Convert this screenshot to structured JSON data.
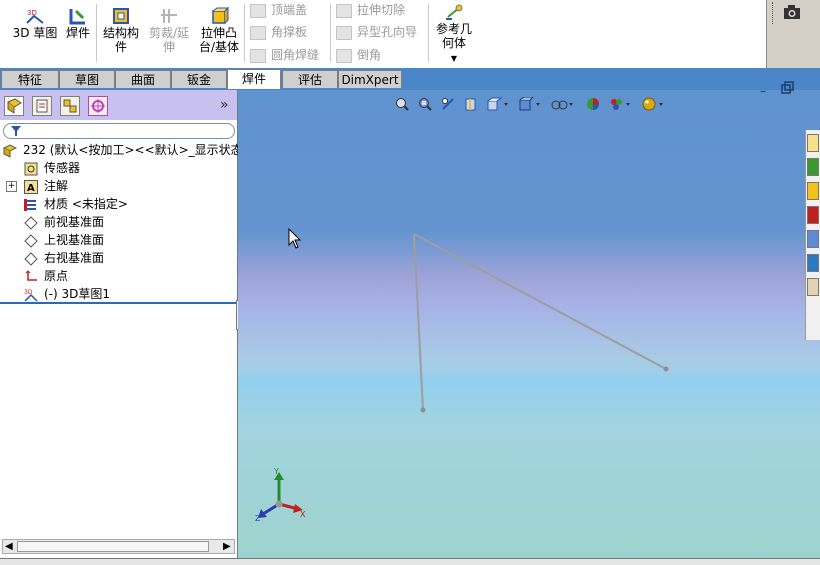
{
  "ribbon": {
    "sketch3d_label": "3D 草图",
    "weldment_label": "焊件",
    "structural_label_line1": "结构构",
    "structural_label_line2": "件",
    "trim_label_line1": "剪裁/延",
    "trim_label_line2": "伸",
    "extrude_label_line1": "拉伸凸",
    "extrude_label_line2": "台/基体",
    "end_cap_label": "顶端盖",
    "gusset_label": "角撑板",
    "fillet_bead_label": "圆角焊缝",
    "extrude_cut_label": "拉伸切除",
    "hole_wizard_label": "异型孔向导",
    "chamfer_label": "倒角",
    "ref_geometry_label_line1": "参考几",
    "ref_geometry_label_line2": "何体"
  },
  "tabs": [
    {
      "label": "特征"
    },
    {
      "label": "草图"
    },
    {
      "label": "曲面"
    },
    {
      "label": "钣金"
    },
    {
      "label": "焊件"
    },
    {
      "label": "评估"
    },
    {
      "label": "DimXpert"
    }
  ],
  "tree": {
    "root": "232  (默认<按加工><<默认>_显示状态",
    "items": [
      {
        "label": "传感器"
      },
      {
        "label": "注解"
      },
      {
        "label": "材质 <未指定>"
      },
      {
        "label": "前视基准面"
      },
      {
        "label": "上视基准面"
      },
      {
        "label": "右视基准面"
      },
      {
        "label": "原点"
      },
      {
        "label": "(-) 3D草图1"
      }
    ]
  },
  "triad": {
    "x": "X",
    "y": "Y",
    "z": "Z"
  },
  "colors": {
    "accent": "#4a86c8",
    "tree_panel": "#c8c0ee",
    "sketch_line": "#9e9e9e"
  }
}
